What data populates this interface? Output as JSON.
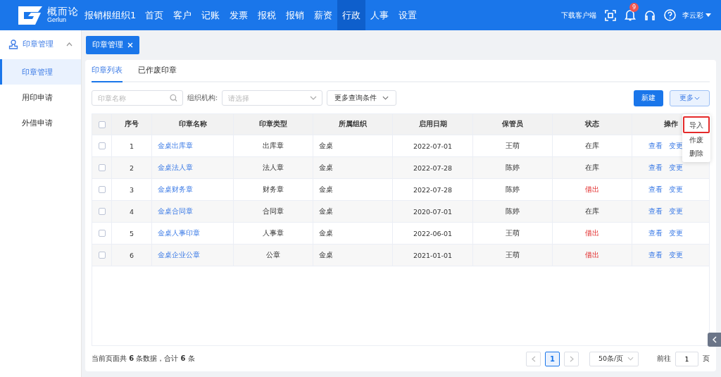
{
  "header": {
    "logo": {
      "name": "概而论",
      "sub": "Gerlun"
    },
    "org": "报销根组织1",
    "nav": [
      {
        "label": "首页",
        "selected": false
      },
      {
        "label": "客户",
        "selected": false
      },
      {
        "label": "记账",
        "selected": false
      },
      {
        "label": "发票",
        "selected": false
      },
      {
        "label": "报税",
        "selected": false
      },
      {
        "label": "报销",
        "selected": false
      },
      {
        "label": "薪资",
        "selected": false
      },
      {
        "label": "行政",
        "selected": true
      },
      {
        "label": "人事",
        "selected": false
      },
      {
        "label": "设置",
        "selected": false
      }
    ],
    "download": "下载客户端",
    "notification_count": "9",
    "user": "李云彩"
  },
  "sidebar": {
    "group": {
      "label": "印章管理",
      "expanded": true
    },
    "items": [
      {
        "label": "印章管理",
        "selected": true
      },
      {
        "label": "用印申请",
        "selected": false
      },
      {
        "label": "外借申请",
        "selected": false
      }
    ]
  },
  "page_tabs": [
    {
      "label": "印章管理",
      "selected": true
    }
  ],
  "tabs": [
    {
      "label": "印章列表",
      "selected": true
    },
    {
      "label": "已作废印章",
      "selected": false
    }
  ],
  "filters": {
    "search_placeholder": "印章名称",
    "org_label": "组织机构:",
    "org_placeholder": "请选择",
    "more_conditions": "更多查询条件"
  },
  "actions": {
    "new": "新建",
    "more": "更多",
    "menu": [
      {
        "label": "导入",
        "highlighted": true
      },
      {
        "label": "作废",
        "highlighted": false
      },
      {
        "label": "删除",
        "highlighted": false
      }
    ]
  },
  "table": {
    "all_checked": false,
    "columns": [
      "序号",
      "印章名称",
      "印章类型",
      "所属组织",
      "启用日期",
      "保管员",
      "状态",
      "操作"
    ],
    "rows": [
      {
        "checked": false,
        "no": "1",
        "name": "金桌出库章",
        "type": "出库章",
        "org": "金桌",
        "date": "2022-07-01",
        "keeper": "王萌",
        "status": "在库",
        "on_loan": false,
        "ops": [
          "查看",
          "变更"
        ]
      },
      {
        "checked": false,
        "no": "2",
        "name": "金桌法人章",
        "type": "法人章",
        "org": "金桌",
        "date": "2022-07-28",
        "keeper": "陈婷",
        "status": "在库",
        "on_loan": false,
        "ops": [
          "查看",
          "变更"
        ]
      },
      {
        "checked": false,
        "no": "3",
        "name": "金桌财务章",
        "type": "财务章",
        "org": "金桌",
        "date": "2022-07-28",
        "keeper": "陈婷",
        "status": "借出",
        "on_loan": true,
        "ops": [
          "查看",
          "变更"
        ]
      },
      {
        "checked": false,
        "no": "4",
        "name": "金桌合同章",
        "type": "合同章",
        "org": "金桌",
        "date": "2020-07-01",
        "keeper": "陈婷",
        "status": "在库",
        "on_loan": false,
        "ops": [
          "查看",
          "变更"
        ]
      },
      {
        "checked": false,
        "no": "5",
        "name": "金桌人事印章",
        "type": "人事章",
        "org": "金桌",
        "date": "2022-06-01",
        "keeper": "王萌",
        "status": "借出",
        "on_loan": true,
        "ops": [
          "查看",
          "变更"
        ]
      },
      {
        "checked": false,
        "no": "6",
        "name": "金桌企业公章",
        "type": "公章",
        "org": "金桌",
        "date": "2021-01-01",
        "keeper": "王萌",
        "status": "借出",
        "on_loan": true,
        "ops": [
          "查看",
          "变更"
        ]
      }
    ]
  },
  "footer": {
    "summary": "当前页面共 **6** 条数据，合计 **6** 条",
    "pages": [
      {
        "label": "1",
        "selected": true
      }
    ],
    "page_size": "50条/页",
    "goto_label": "前往",
    "goto_value": "1",
    "goto_unit": "页"
  }
}
